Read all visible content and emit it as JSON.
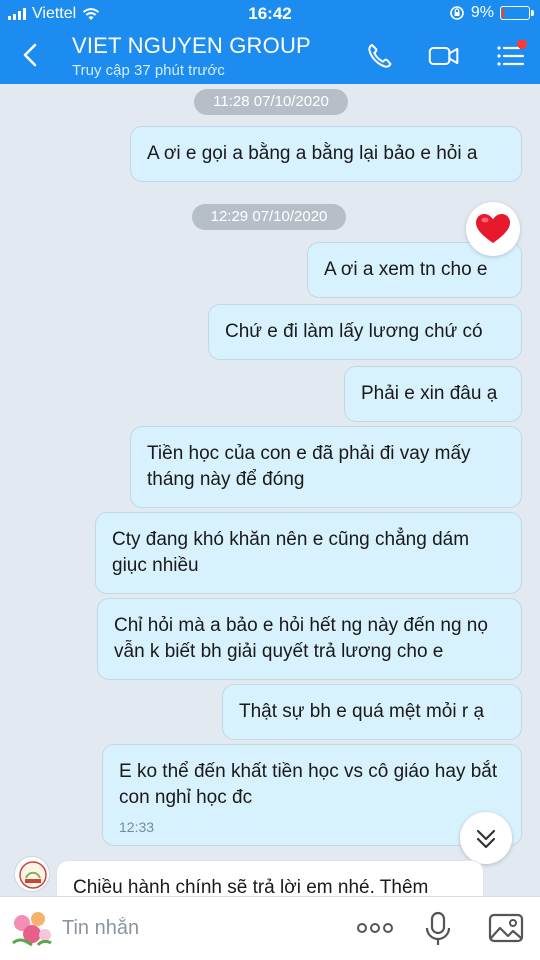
{
  "status_bar": {
    "carrier": "Viettel",
    "time": "16:42",
    "battery_percent": "9%",
    "battery_level": 0.09
  },
  "header": {
    "title": "VIET NGUYEN GROUP",
    "subtitle": "Truy cập 37 phút trước"
  },
  "messages": [
    {
      "type": "timestamp",
      "text": "11:28 07/10/2020"
    },
    {
      "type": "sent",
      "text": "A ơi e gọi a bằng a bằng lại bảo e hỏi a"
    },
    {
      "type": "timestamp",
      "text": "12:29 07/10/2020"
    },
    {
      "type": "sent",
      "text": "A ơi a xem tn cho e",
      "reaction": "heart"
    },
    {
      "type": "sent",
      "text": "Chứ e đi làm lấy lương chứ có"
    },
    {
      "type": "sent",
      "text": "Phải e xin đâu ạ"
    },
    {
      "type": "sent",
      "text": "Tiền học của con e đã phải đi vay mấy tháng này để đóng"
    },
    {
      "type": "sent",
      "text": "Cty đang khó khăn nên e cũng chẳng dám giục nhiều"
    },
    {
      "type": "sent",
      "text": "Chỉ hỏi mà a bảo e hỏi hết ng này đến ng nọ vẫn k biết bh giải quyết trả lương cho e"
    },
    {
      "type": "sent",
      "text": "Thật sự bh e quá mệt mỏi r ạ"
    },
    {
      "type": "sent",
      "text": "E ko thể đến khất tiền học vs cô giáo hay bắt con nghỉ học đc",
      "time": "12:33"
    },
    {
      "type": "received",
      "text": "Chiều hành chính sẽ trả lời em nhé. Thêm"
    }
  ],
  "composer": {
    "placeholder": "Tin nhắn"
  },
  "colors": {
    "header": "#1d8cf0",
    "chat_bg": "#e2e9f1",
    "sent_bubble": "#d7f1fd",
    "received_bubble": "#ffffff",
    "heart": "#e8192c"
  },
  "icons": [
    "back-arrow-icon",
    "phone-icon",
    "video-call-icon",
    "menu-icon",
    "heart-icon",
    "chevron-down-icon",
    "sticker-icon",
    "more-icon",
    "microphone-icon",
    "image-icon"
  ]
}
